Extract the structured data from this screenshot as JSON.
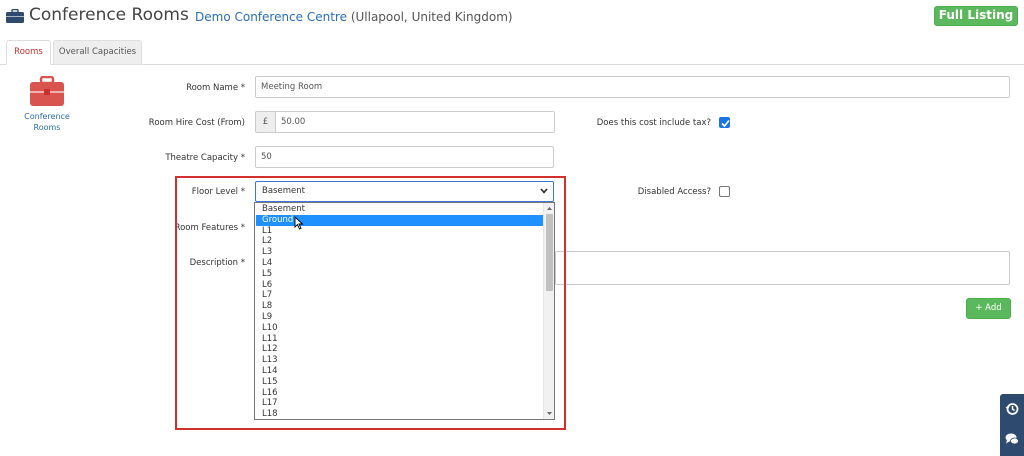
{
  "header": {
    "title": "Conference Rooms",
    "venue": "Demo Conference Centre",
    "location": "(Ullapool, United Kingdom)",
    "full_listing_label": "Full Listing"
  },
  "tabs": [
    {
      "label": "Rooms",
      "active": true
    },
    {
      "label": "Overall Capacities",
      "active": false
    }
  ],
  "sidebar": {
    "label": "Conference Rooms",
    "icon": "briefcase-icon",
    "icon_color": "#d9534f"
  },
  "form": {
    "room_name": {
      "label": "Room Name *",
      "value": "Meeting Room"
    },
    "room_hire_cost": {
      "label": "Room Hire Cost (From)",
      "currency": "£",
      "value": "50.00"
    },
    "cost_includes_tax": {
      "label": "Does this cost include tax?",
      "checked": true
    },
    "theatre_capacity": {
      "label": "Theatre Capacity *",
      "value": "50"
    },
    "floor_level": {
      "label": "Floor Level *",
      "value": "Basement"
    },
    "disabled_access": {
      "label": "Disabled Access?",
      "checked": false
    },
    "room_features": {
      "label": "Room Features *"
    },
    "description": {
      "label": "Description *"
    },
    "add_button_label": "+ Add"
  },
  "dropdown": {
    "options": [
      "Basement",
      "Ground",
      "L1",
      "L2",
      "L3",
      "L4",
      "L5",
      "L6",
      "L7",
      "L8",
      "L9",
      "L10",
      "L11",
      "L12",
      "L13",
      "L14",
      "L15",
      "L16",
      "L17",
      "L18"
    ],
    "highlighted": "Ground"
  },
  "colors": {
    "accent_green": "#5cb85c",
    "link_blue": "#2a6ebb",
    "highlight_red": "#d32f2f",
    "selection_blue": "#1e90ff"
  }
}
